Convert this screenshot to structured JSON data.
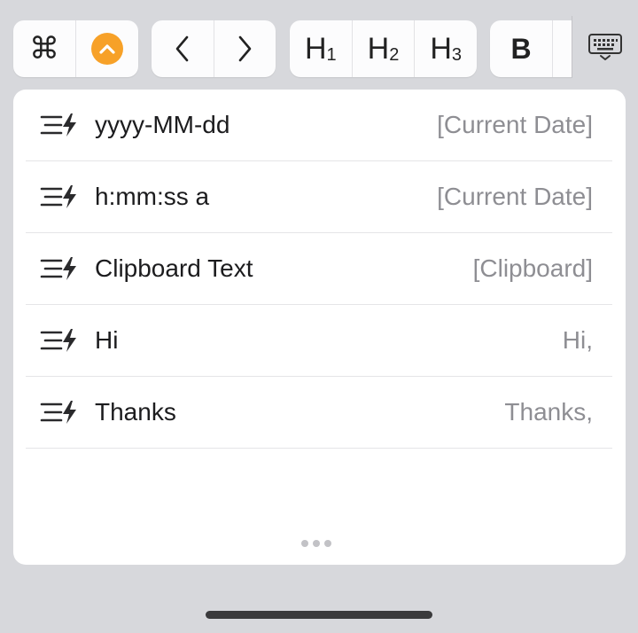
{
  "toolbar": {
    "command_icon": "command-icon",
    "expand_icon": "chevron-up-icon",
    "back_icon": "chevron-left-icon",
    "forward_icon": "chevron-right-icon",
    "h1": {
      "letter": "H",
      "level": "1"
    },
    "h2": {
      "letter": "H",
      "level": "2"
    },
    "h3": {
      "letter": "H",
      "level": "3"
    },
    "bold_label": "B",
    "keyboard_icon": "keyboard-dismiss-icon",
    "accent_color": "#f7a128"
  },
  "snippets": [
    {
      "title": "yyyy-MM-dd",
      "value": "[Current Date]",
      "icon": "snippet-bolt-icon"
    },
    {
      "title": "h:mm:ss a",
      "value": "[Current Date]",
      "icon": "snippet-bolt-icon"
    },
    {
      "title": "Clipboard Text",
      "value": "[Clipboard]",
      "icon": "snippet-bolt-icon"
    },
    {
      "title": "Hi",
      "value": "Hi,",
      "icon": "snippet-bolt-icon"
    },
    {
      "title": "Thanks",
      "value": "Thanks,",
      "icon": "snippet-bolt-icon"
    }
  ],
  "more_indicator": "ellipsis-icon"
}
